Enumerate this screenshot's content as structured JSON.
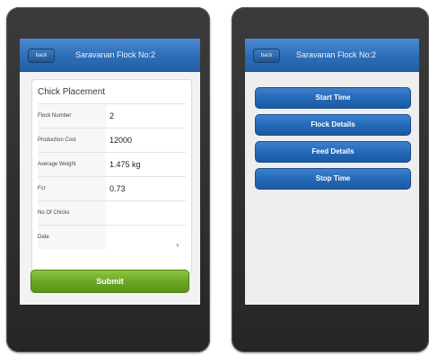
{
  "left_screen": {
    "header": {
      "back_label": "back",
      "title": "Saravanan  Flock No:2"
    },
    "form": {
      "title": "Chick Placement",
      "fields": [
        {
          "label": "Flock Number",
          "value": "2"
        },
        {
          "label": "Production Cost",
          "value": "12000"
        },
        {
          "label": "Average Weight",
          "value": "1.475 kg"
        },
        {
          "label": "Fcr",
          "value": "0.73"
        },
        {
          "label": "No Of Chicks",
          "value": ""
        },
        {
          "label": "Date",
          "value": ""
        }
      ]
    },
    "submit_label": "Submit"
  },
  "right_screen": {
    "header": {
      "back_label": "back",
      "title": "Saravanan  Flock No:2"
    },
    "menu": [
      {
        "label": "Start Time"
      },
      {
        "label": "Flock Details"
      },
      {
        "label": "Feed Details"
      },
      {
        "label": "Stop Time"
      }
    ]
  },
  "colors": {
    "header_blue": "#2d6db8",
    "button_blue": "#2368b6",
    "submit_green": "#6aa624",
    "phone_frame": "#2e2e2e"
  }
}
